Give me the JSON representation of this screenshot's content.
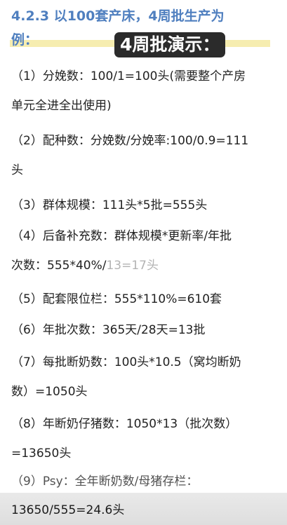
{
  "heading": {
    "line1": "4.2.3 以100套产床，4周批生产为",
    "line2": "例："
  },
  "overlay_title": "4周批演示：",
  "items": [
    {
      "line1": "（1）分娩数：100/1=100头(需要整个产房",
      "line2": "单元全进全出使用)"
    },
    {
      "line1": "（2）配种数：分娩数/分娩率:100/0.9=111",
      "line2": "头"
    },
    {
      "line1": "（3）群体规模：111头*5批=555头"
    },
    {
      "line1": "（4）后备补充数：群体规模*更新率/年批",
      "line2a": "次数：555*40%/",
      "line2b": "13=17头"
    },
    {
      "line1": "（5）配套限位栏：555*110%=610套"
    },
    {
      "line1": "（6）年批次数：365天/28天=13批"
    },
    {
      "line1": "（7）每批断奶数：100头*10.5（窝均断奶",
      "line2": "数）=1050头"
    },
    {
      "line1": "（8）年断奶仔猪数：1050*13（批次数）",
      "line2": "=13650头"
    },
    {
      "line1": "（9）Psy：全年断奶数/母猪存栏："
    }
  ],
  "bottom_text": "13650/555=24.6头"
}
